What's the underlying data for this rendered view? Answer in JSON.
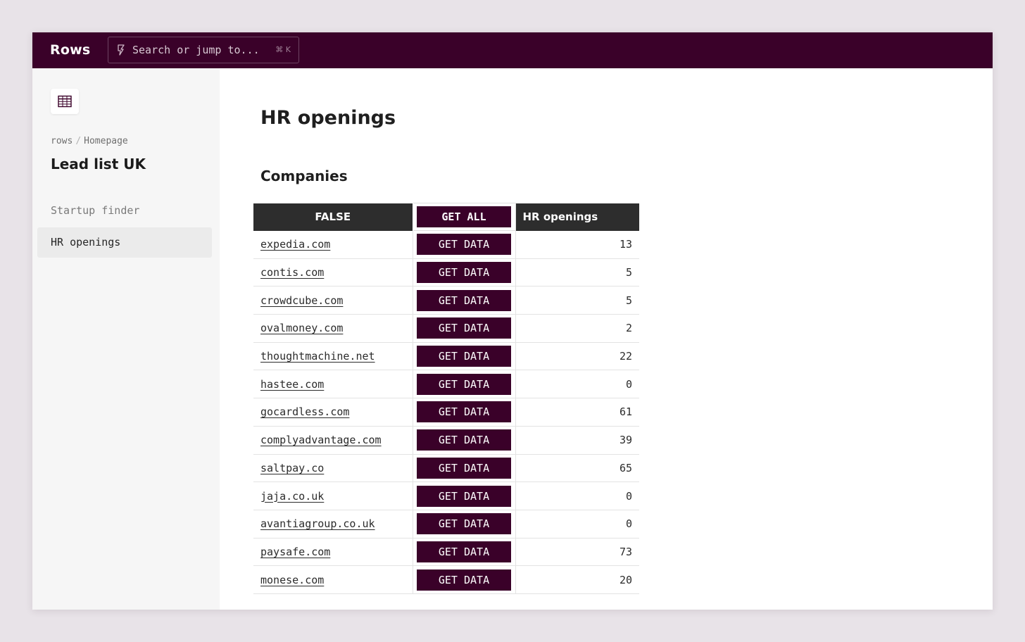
{
  "app": {
    "brand": "Rows",
    "search": {
      "placeholder": "Search or jump to...",
      "shortcut": "⌘ K",
      "icon": "spark-icon"
    }
  },
  "sidebar": {
    "icon": "spreadsheet-icon",
    "breadcrumb": [
      "rows",
      "Homepage"
    ],
    "breadcrumb_separator": "/",
    "doc_title": "Lead list UK",
    "items": [
      {
        "label": "Startup finder",
        "active": false
      },
      {
        "label": "HR openings",
        "active": true
      }
    ]
  },
  "main": {
    "page_title": "HR openings",
    "section_title": "Companies",
    "table": {
      "headers": {
        "col1": "FALSE",
        "col2_button": "GET ALL",
        "col3": "HR openings"
      },
      "row_button_label": "GET DATA",
      "rows": [
        {
          "domain": "expedia.com",
          "openings": "13"
        },
        {
          "domain": "contis.com",
          "openings": "5"
        },
        {
          "domain": "crowdcube.com",
          "openings": "5"
        },
        {
          "domain": "ovalmoney.com",
          "openings": "2"
        },
        {
          "domain": "thoughtmachine.net",
          "openings": "22"
        },
        {
          "domain": "hastee.com",
          "openings": "0"
        },
        {
          "domain": "gocardless.com",
          "openings": "61"
        },
        {
          "domain": "complyadvantage.com",
          "openings": "39"
        },
        {
          "domain": "saltpay.co",
          "openings": "65"
        },
        {
          "domain": "jaja.co.uk",
          "openings": "0"
        },
        {
          "domain": "avantiagroup.co.uk",
          "openings": "0"
        },
        {
          "domain": "paysafe.com",
          "openings": "73"
        },
        {
          "domain": "monese.com",
          "openings": "20"
        }
      ]
    }
  },
  "colors": {
    "brand": "#3a0129",
    "header_dark": "#2d2d2d",
    "sidebar_bg": "#f6f6f6",
    "page_bg": "#e8e3e8"
  }
}
